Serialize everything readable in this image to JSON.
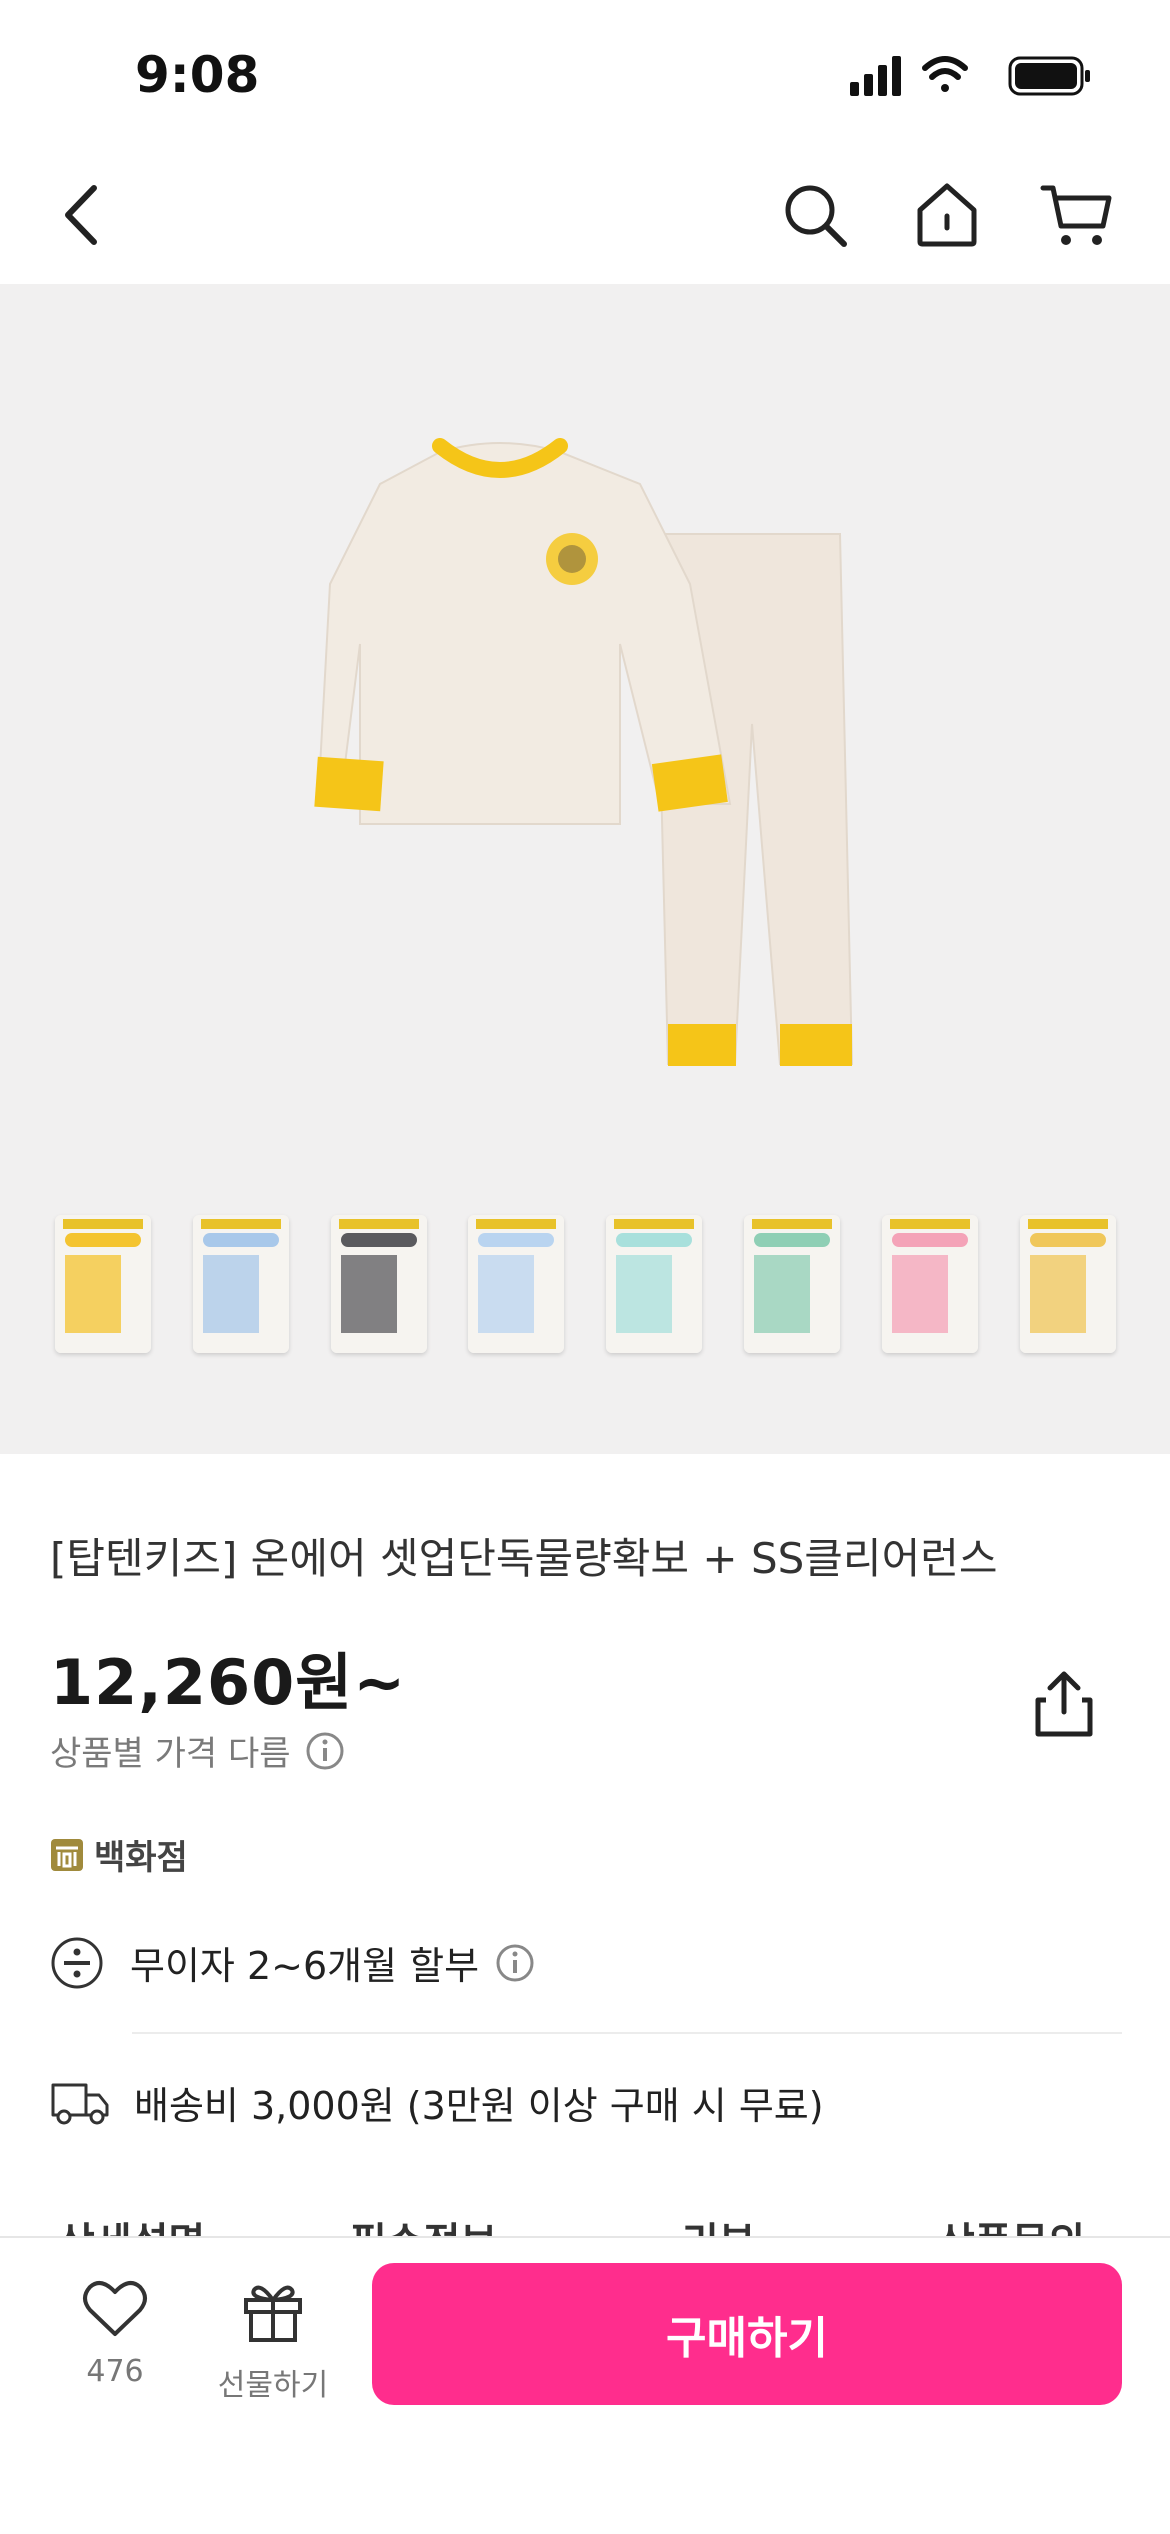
{
  "status_bar": {
    "time": "9:08"
  },
  "nav": {
    "icons": [
      "back-arrow-icon",
      "search-icon",
      "home-icon",
      "cart-icon"
    ]
  },
  "gallery": {
    "thumbnails": [
      {
        "color": "#f4c430"
      },
      {
        "color": "#a8c8ea"
      },
      {
        "color": "#5a5a5e"
      },
      {
        "color": "#b9d4f0"
      },
      {
        "color": "#a8e0dc"
      },
      {
        "color": "#8fcfb5"
      },
      {
        "color": "#f4a3b8"
      },
      {
        "color": "#f0c75a"
      }
    ]
  },
  "product": {
    "title": "[탑텐키즈] 온에어 셋업단독물량확보 + SS클리어런스",
    "price": "12,260원~",
    "price_note": "상품별 가격 다름",
    "badge": "백화점",
    "installment": "무이자 2~6개월 할부",
    "shipping": "배송비 3,000원 (3만원 이상 구매 시 무료)"
  },
  "tabs": [
    "상세설명",
    "필수정보",
    "리뷰",
    "상품문의"
  ],
  "bottom_bar": {
    "wish_count": "476",
    "gift_label": "선물하기",
    "buy_label": "구매하기"
  },
  "colors": {
    "accent": "#ff2d8d",
    "gallery_bg": "#f1f0f0",
    "pajama_trim": "#f5c518"
  }
}
